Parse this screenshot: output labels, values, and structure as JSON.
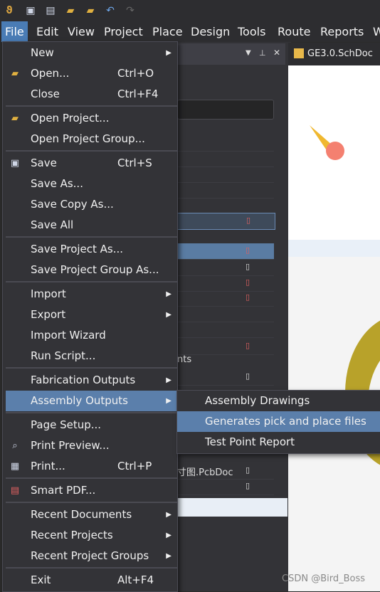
{
  "menubar": {
    "items": [
      "File",
      "Edit",
      "View",
      "Project",
      "Place",
      "Design",
      "Tools",
      "Route",
      "Reports",
      "W"
    ]
  },
  "doc_tab": {
    "label": "GE3.0.SchDoc"
  },
  "panel_fragments": {
    "nts": "nts",
    "pcbdoc": "寸图.PcbDoc"
  },
  "file_menu": {
    "new": "New",
    "open": "Open...",
    "open_sc": "Ctrl+O",
    "close": "Close",
    "close_sc": "Ctrl+F4",
    "open_project": "Open Project...",
    "open_project_group": "Open Project Group...",
    "save": "Save",
    "save_sc": "Ctrl+S",
    "save_as": "Save As...",
    "save_copy_as": "Save Copy As...",
    "save_all": "Save All",
    "save_project_as": "Save Project As...",
    "save_project_group_as": "Save Project Group As...",
    "import": "Import",
    "export": "Export",
    "import_wizard": "Import Wizard",
    "run_script": "Run Script...",
    "fabrication_outputs": "Fabrication Outputs",
    "assembly_outputs": "Assembly Outputs",
    "page_setup": "Page Setup...",
    "print_preview": "Print Preview...",
    "print": "Print...",
    "print_sc": "Ctrl+P",
    "smart_pdf": "Smart PDF...",
    "recent_documents": "Recent Documents",
    "recent_projects": "Recent Projects",
    "recent_project_groups": "Recent Project Groups",
    "exit": "Exit",
    "exit_sc": "Alt+F4"
  },
  "assembly_submenu": {
    "assembly_drawings": "Assembly Drawings",
    "generates_pick_place": "Generates pick and place files",
    "test_point_report": "Test Point Report"
  },
  "watermark": "CSDN @Bird_Boss"
}
